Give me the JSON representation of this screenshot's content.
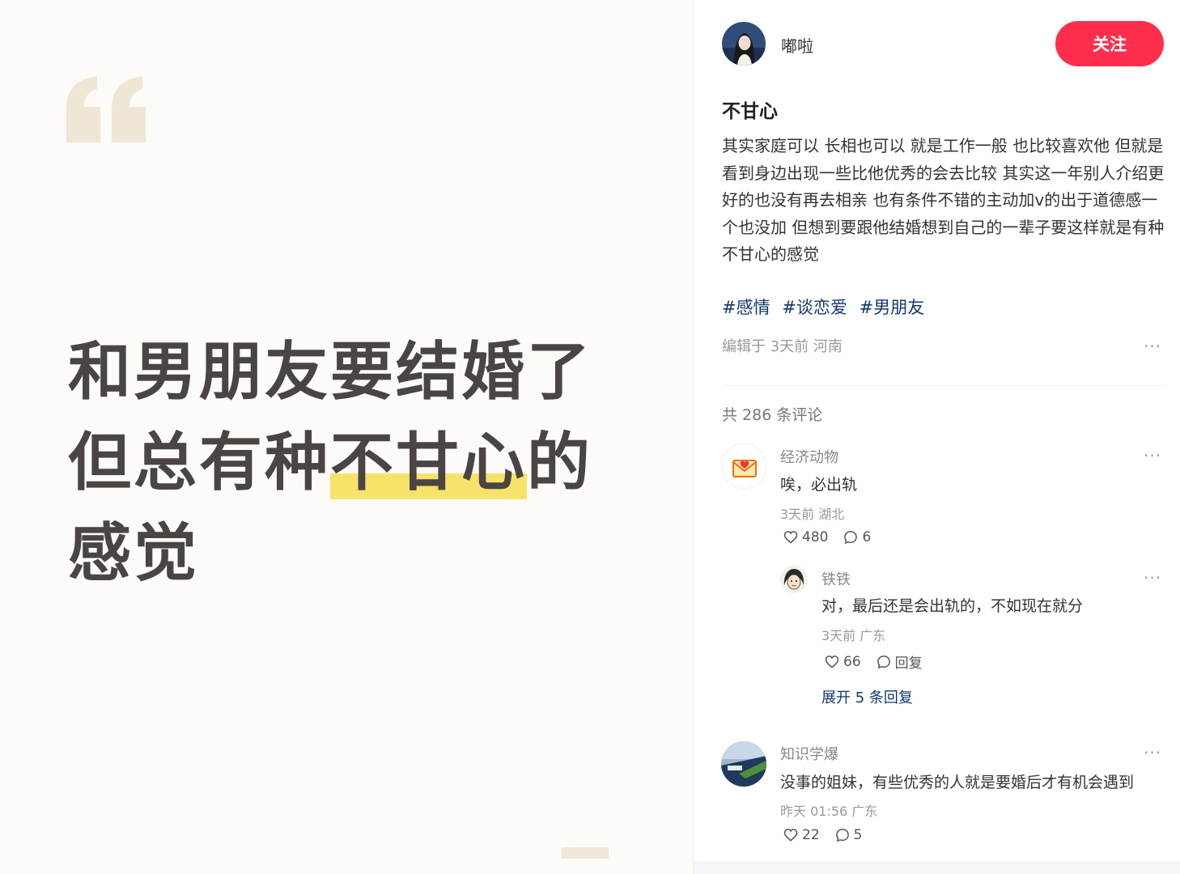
{
  "image": {
    "headline_lines": [
      "和男朋友要结婚了",
      "但总有种",
      "不甘心",
      "的",
      "感觉"
    ]
  },
  "author": {
    "name": "嘟啦",
    "follow_label": "关注"
  },
  "note": {
    "title": "不甘心",
    "body": "其实家庭可以 长相也可以 就是工作一般 也比较喜欢他 但就是看到身边出现一些比他优秀的会去比较 其实这一年别人介绍更好的也没有再去相亲 也有条件不错的主动加v的出于道德感一个也没加 但想到要跟他结婚想到自己的一辈子要这样就是有种不甘心的感觉",
    "tags": [
      "#感情",
      "#谈恋爱",
      "#男朋友"
    ],
    "meta": "编辑于 3天前 河南"
  },
  "comments_header": "共 286 条评论",
  "more_glyph": "···",
  "comments": [
    {
      "user": "经济动物",
      "text": "唉，必出轨",
      "meta": "3天前 湖北",
      "likes": "480",
      "replies": "6",
      "sub": [
        {
          "user": "铁铁",
          "text": "对，最后还是会出轨的，不如现在就分",
          "meta": "3天前 广东",
          "likes": "66",
          "reply_label": "回复"
        }
      ],
      "expand_label": "展开 5 条回复"
    },
    {
      "user": "知识学爆",
      "text": "没事的姐妹，有些优秀的人就是要婚后才有机会遇到",
      "meta": "昨天 01:56 广东",
      "likes": "22",
      "replies": "5"
    }
  ],
  "colors": {
    "accent": "#ff2e4d",
    "tag": "#13386c",
    "highlight": "#f7e26a",
    "quote": "#efe7d6"
  },
  "icons": [
    "quote-icon",
    "heart-icon",
    "comment-icon",
    "more-icon"
  ]
}
